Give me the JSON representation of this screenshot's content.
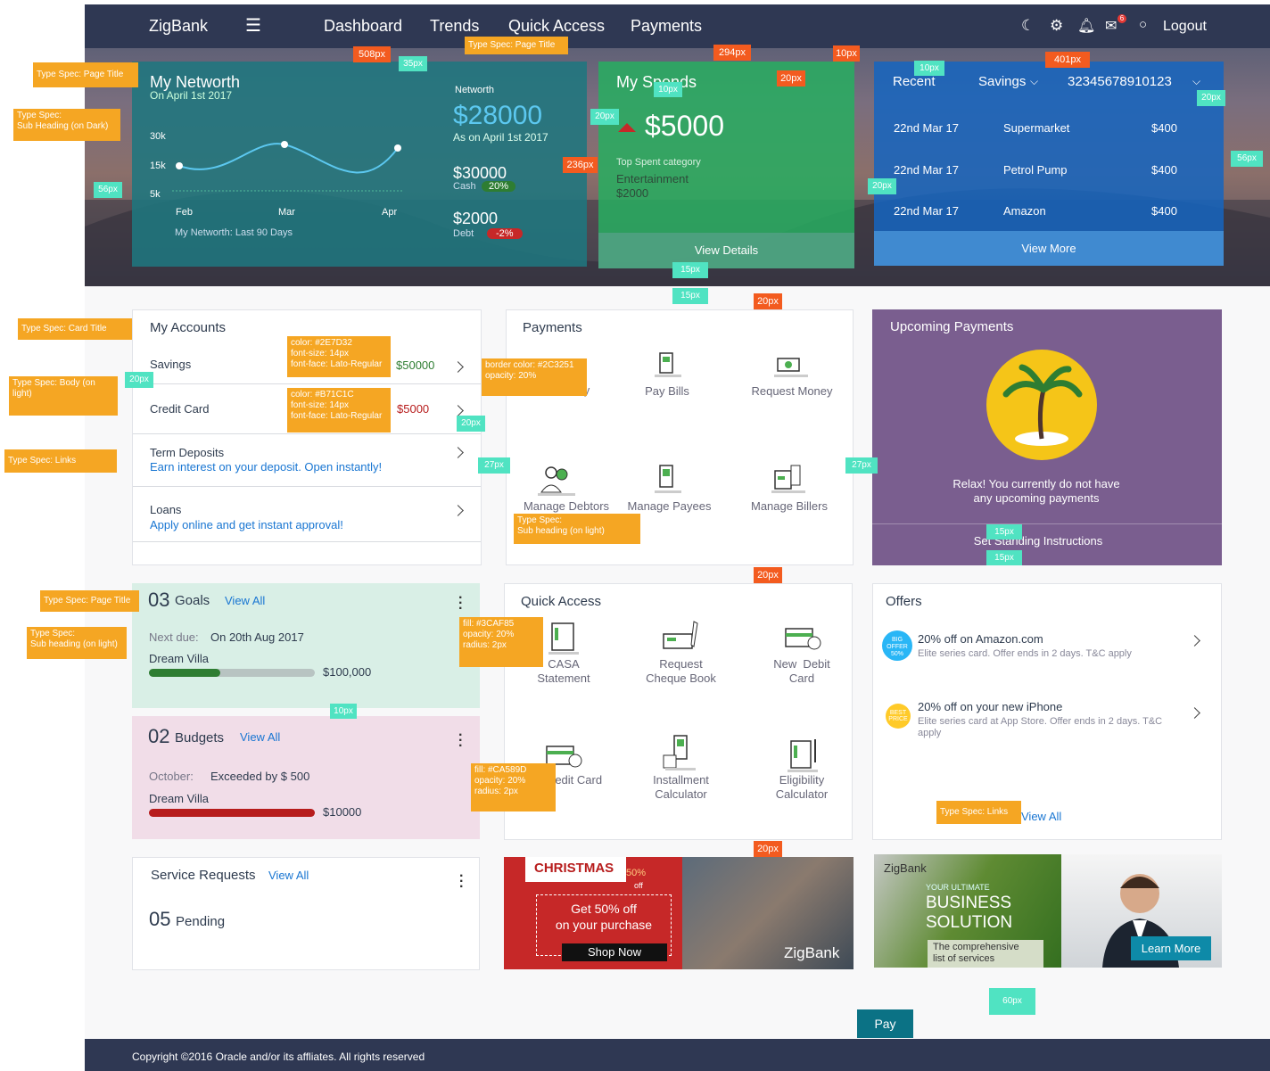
{
  "nav": {
    "brand": "ZigBank",
    "items": [
      "Dashboard",
      "Trends",
      "Quick Access",
      "Payments"
    ],
    "logout": "Logout",
    "mail_badge": "6"
  },
  "networth": {
    "title": "My Networth",
    "subtitle": "On April 1st 2017",
    "y_ticks": [
      "30k",
      "15k",
      "5k"
    ],
    "x_ticks": [
      "Feb",
      "Mar",
      "Apr"
    ],
    "caption": "My Networth: Last 90 Days",
    "label": "Networth",
    "amount": "$28000",
    "as_on": "As on April 1st 2017",
    "cash_amount": "$30000",
    "cash_label": "Cash",
    "cash_badge": "20%",
    "debt_amount": "$2000",
    "debt_label": "Debt",
    "debt_badge": "-2%"
  },
  "spends": {
    "title": "My Spends",
    "amount": "$5000",
    "top_label": "Top Spent category",
    "top_category": "Entertainment",
    "top_amount": "$2000",
    "button": "View Details"
  },
  "recent": {
    "title": "Recent",
    "account_type": "Savings",
    "account_no": "32345678910123",
    "rows": [
      {
        "date": "22nd Mar 17",
        "desc": "Supermarket",
        "amt": "$400"
      },
      {
        "date": "22nd Mar 17",
        "desc": "Petrol Pump",
        "amt": "$400"
      },
      {
        "date": "22nd Mar 17",
        "desc": "Amazon",
        "amt": "$400"
      }
    ],
    "button": "View More"
  },
  "accounts": {
    "title": "My Accounts",
    "savings": "Savings",
    "savings_amt": "$50000",
    "credit": "Credit Card",
    "credit_amt": "$5000",
    "term": "Term Deposits",
    "term_link": "Earn interest on your deposit. Open instantly!",
    "loans": "Loans",
    "loans_link": "Apply online and get instant approval!"
  },
  "payments": {
    "title": "Payments",
    "items": [
      "Pay Bills",
      "Request Money",
      "Manage Debtors",
      "Manage Payees",
      "Manage Billers"
    ],
    "partial": "y"
  },
  "upcoming": {
    "title": "Upcoming Payments",
    "message1": "Relax! You currently do not have",
    "message2": "any upcoming payments",
    "button": "Set Standing Instructions"
  },
  "goals": {
    "count": "03",
    "title": "Goals",
    "view_all": "View All",
    "due_label": "Next due:",
    "due_value": "On  20th Aug 2017",
    "item": "Dream Villa",
    "amount": "$100,000",
    "progress": 0.43
  },
  "budgets": {
    "count": "02",
    "title": "Budgets",
    "view_all": "View All",
    "month": "October:",
    "status": "Exceeded by $ 500",
    "item": "Dream Villa",
    "amount": "$10000",
    "progress": 1.0
  },
  "quick": {
    "title": "Quick Access",
    "items": [
      "CASA\nStatement",
      "Request\nCheque Book",
      "New  Debit\nCard",
      "redit Card",
      "Installment\nCalculator",
      "Eligibility\nCalculator"
    ]
  },
  "offers": {
    "title": "Offers",
    "items": [
      {
        "title": "20% off on Amazon.com",
        "desc": "Elite series card. Offer ends in 2 days. T&C apply",
        "badge": "BIG OFFER 50%"
      },
      {
        "title": "20% off on your new iPhone",
        "desc": "Elite series card at App Store. Offer ends in 2 days. T&C apply",
        "badge": "BEST PRICE"
      }
    ],
    "view_all": "View All"
  },
  "service": {
    "title": "Service Requests",
    "view_all": "View All",
    "count": "05",
    "status": "Pending"
  },
  "promo1": {
    "tag": "CHRISTMAS",
    "badge_pct": "50%",
    "badge_off": "off",
    "line1": "Get 50% off",
    "line2": "on your purchase",
    "button": "Shop Now",
    "brand": "ZigBank"
  },
  "promo2": {
    "brand": "ZigBank",
    "small": "YOUR ULTIMATE",
    "big1": "BUSINESS",
    "big2": "SOLUTION",
    "sub1": "The comprehensive",
    "sub2": "list of services",
    "button": "Learn More"
  },
  "pay_button": "Pay",
  "footer": "Copyright ©2016 Oracle and/or its affliates. All rights reserved",
  "annotations": {
    "page_title": "Type Spec: Page Title",
    "sub_dark": "Type Spec:\nSub Heading (on Dark)",
    "card_title": "Type Spec: Card Title",
    "body_light": "Type Spec: Body (on light)",
    "links": "Type Spec: Links",
    "sub_light": "Type Spec:\nSub heading (on light)",
    "savings_spec": "color: #2E7D32\nfont-size: 14px\nfont-face: Lato-Regular",
    "credit_spec": "color: #B71C1C\nfont-size: 14px\nfont-face: Lato-Regular",
    "border_spec": "border color: #2C3251\nopacity: 20%",
    "goal_fill": "fill: #3CAF85\nopacity: 20%\nradius: 2px",
    "budget_fill": "fill: #CA589D\nopacity: 20%\nradius: 2px",
    "px508": "508px",
    "px35": "35px",
    "px294": "294px",
    "px401": "401px",
    "px10": "10px",
    "px20": "20px",
    "px236": "236px",
    "px56": "56px",
    "px15": "15px",
    "px27": "27px",
    "px60": "60px"
  }
}
